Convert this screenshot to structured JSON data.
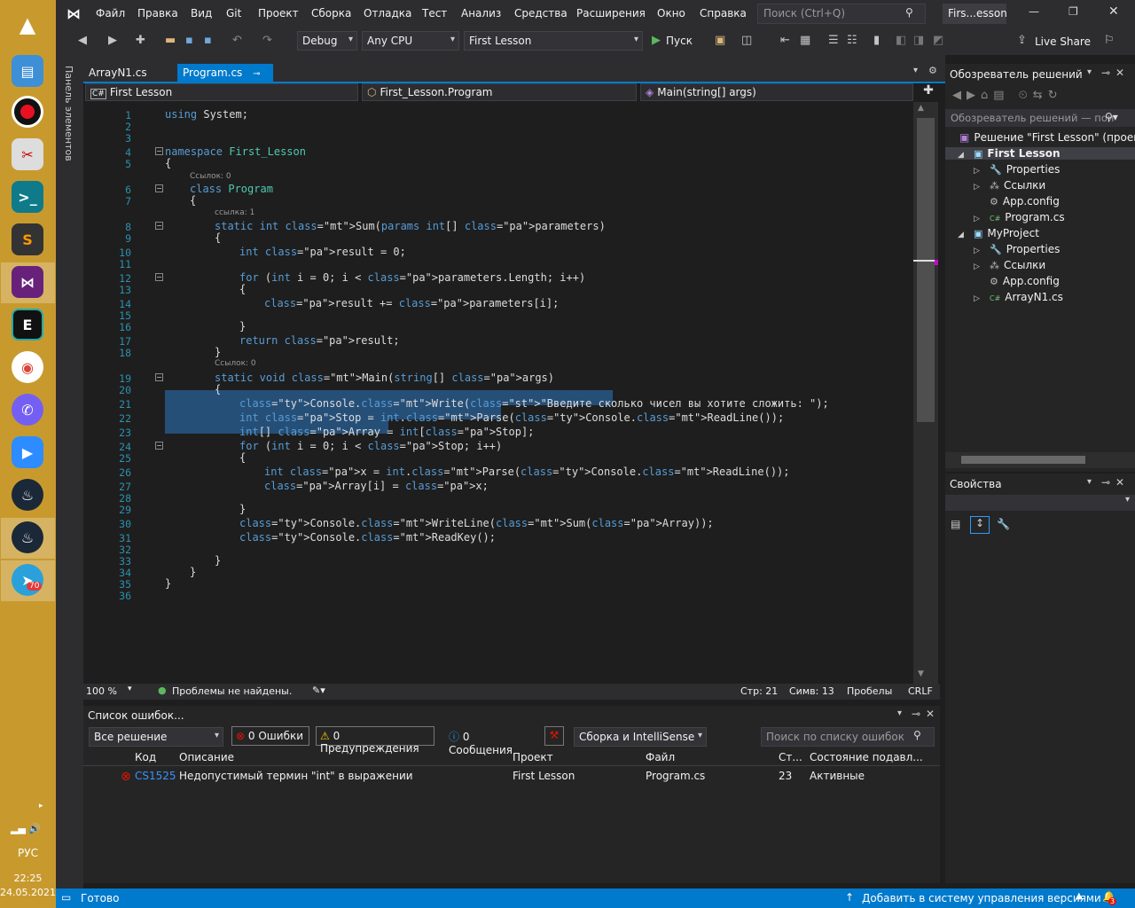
{
  "taskbar": {
    "lang": "РУС",
    "time": "22:25",
    "date": "24.05.2021",
    "badge": "70"
  },
  "menu": [
    "Файл",
    "Правка",
    "Вид",
    "Git",
    "Проект",
    "Сборка",
    "Отладка",
    "Тест",
    "Анализ",
    "Средства",
    "Расширения",
    "Окно",
    "Справка"
  ],
  "search_placeholder": "Поиск (Ctrl+Q)",
  "window_title": "Firs...esson",
  "toolbar": {
    "config": "Debug",
    "platform": "Any CPU",
    "project": "First Lesson",
    "run": "Пуск",
    "live_share": "Live Share"
  },
  "left_tab": "Панель элементов",
  "tabs": [
    {
      "label": "ArrayN1.cs"
    },
    {
      "label": "Program.cs"
    }
  ],
  "nav": {
    "project": "First Lesson",
    "class": "First_Lesson.Program",
    "member": "Main(string[] args)"
  },
  "code_lines": [
    "using System;",
    "",
    "",
    "namespace First_Lesson",
    "{",
    "class Program",
    "{",
    "static int Sum(params int[] parameters)",
    "{",
    "int result = 0;",
    "",
    "for (int i = 0; i < parameters.Length; i++)",
    "{",
    "result += parameters[i];",
    "",
    "}",
    "return result;",
    "}",
    "static void Main(string[] args)",
    "{",
    "Console.Write(\"Введите сколько чисел вы хотите сложить: \");",
    "int Stop = int.Parse(Console.ReadLine());",
    "int[] Array = int[Stop];",
    "for (int i = 0; i < Stop; i++)",
    "{",
    "int x = int.Parse(Console.ReadLine());",
    "Array[i] = x;",
    "",
    "}",
    "Console.WriteLine(Sum(Array));",
    "Console.ReadKey();",
    "",
    "}",
    "}",
    "}",
    ""
  ],
  "refs": [
    "Ссылок: 0",
    "ссылка: 1",
    "Ссылок: 0"
  ],
  "editor_status": {
    "zoom": "100 %",
    "problems": "Проблемы не найдены.",
    "line": "Стр: 21",
    "col": "Симв: 13",
    "ws": "Пробелы",
    "eol": "CRLF"
  },
  "errors": {
    "title": "Список ошибок...",
    "scope": "Все решение",
    "errors": "0 Ошибки",
    "warnings": "0 Предупреждения",
    "messages": "0 Сообщения",
    "build": "Сборка и IntelliSense",
    "search": "Поиск по списку ошибок",
    "columns": [
      "Код",
      "Описание",
      "Проект",
      "Файл",
      "Ст...",
      "Состояние подавл..."
    ],
    "rows": [
      {
        "code": "CS1525",
        "desc": "Недопустимый термин \"int\" в выражении",
        "project": "First Lesson",
        "file": "Program.cs",
        "line": "23",
        "state": "Активные"
      }
    ]
  },
  "solution": {
    "title": "Обозреватель решений",
    "search": "Обозреватель решений — пои",
    "root": "Решение \"First Lesson\" (проекты",
    "items": [
      {
        "label": "First Lesson",
        "level": 1,
        "bold": true,
        "icon": "c#-project"
      },
      {
        "label": "Properties",
        "level": 2,
        "icon": "wrench"
      },
      {
        "label": "Ссылки",
        "level": 2,
        "icon": "refs"
      },
      {
        "label": "App.config",
        "level": 2,
        "icon": "config"
      },
      {
        "label": "Program.cs",
        "level": 2,
        "icon": "c#"
      },
      {
        "label": "MyProject",
        "level": 1,
        "icon": "c#-project"
      },
      {
        "label": "Properties",
        "level": 2,
        "icon": "wrench"
      },
      {
        "label": "Ссылки",
        "level": 2,
        "icon": "refs"
      },
      {
        "label": "App.config",
        "level": 2,
        "icon": "config"
      },
      {
        "label": "ArrayN1.cs",
        "level": 2,
        "icon": "c#"
      }
    ]
  },
  "properties_title": "Свойства",
  "status": {
    "ready": "Готово",
    "vcs": "Добавить в систему управления версиями",
    "notif": "3"
  }
}
